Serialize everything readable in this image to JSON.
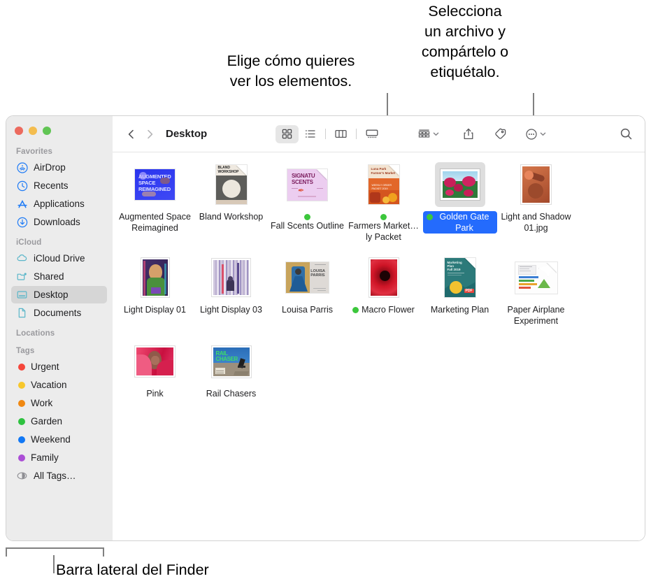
{
  "annotations": {
    "view_modes": "Elige cómo quieres\nver los elementos.",
    "share_tag": "Selecciona\nun archivo y\ncompártelo o\netiquétalo.",
    "sidebar_caption": "Barra lateral del Finder"
  },
  "window": {
    "traffic_lights": [
      "close",
      "minimize",
      "zoom"
    ],
    "title": "Desktop"
  },
  "toolbar": {
    "back_label": "Back",
    "forward_label": "Forward",
    "view_icon": "grid-view-icon",
    "list_icon": "list-view-icon",
    "column_icon": "column-view-icon",
    "gallery_icon": "gallery-view-icon",
    "group_icon": "group-by-icon",
    "share_icon": "share-icon",
    "tag_icon": "tag-icon",
    "more_icon": "more-options-icon",
    "search_icon": "search-icon"
  },
  "sidebar": {
    "sections": [
      {
        "header": "Favorites",
        "items": [
          {
            "label": "AirDrop",
            "icon": "airdrop-icon",
            "color": "#1e7bf6",
            "selected": false
          },
          {
            "label": "Recents",
            "icon": "clock-icon",
            "color": "#1e7bf6",
            "selected": false
          },
          {
            "label": "Applications",
            "icon": "applications-icon",
            "color": "#1e7bf6",
            "selected": false
          },
          {
            "label": "Downloads",
            "icon": "downloads-icon",
            "color": "#1e7bf6",
            "selected": false
          }
        ]
      },
      {
        "header": "iCloud",
        "items": [
          {
            "label": "iCloud Drive",
            "icon": "cloud-icon",
            "color": "#5ab6c9",
            "selected": false
          },
          {
            "label": "Shared",
            "icon": "shared-folder-icon",
            "color": "#5ab6c9",
            "selected": false
          },
          {
            "label": "Desktop",
            "icon": "desktop-icon",
            "color": "#5ab6c9",
            "selected": true
          },
          {
            "label": "Documents",
            "icon": "document-icon",
            "color": "#5ab6c9",
            "selected": false
          }
        ]
      },
      {
        "header": "Locations",
        "items": []
      },
      {
        "header": "Tags",
        "items": [
          {
            "label": "Urgent",
            "icon": "tag-dot",
            "color": "#f5463b",
            "selected": false
          },
          {
            "label": "Vacation",
            "icon": "tag-dot",
            "color": "#f7c72c",
            "selected": false
          },
          {
            "label": "Work",
            "icon": "tag-dot",
            "color": "#f08812",
            "selected": false
          },
          {
            "label": "Garden",
            "icon": "tag-dot",
            "color": "#2ec23f",
            "selected": false
          },
          {
            "label": "Weekend",
            "icon": "tag-dot",
            "color": "#1178f5",
            "selected": false
          },
          {
            "label": "Family",
            "icon": "tag-dot",
            "color": "#ab4ed6",
            "selected": false
          },
          {
            "label": "All Tags…",
            "icon": "all-tags-icon",
            "color": "#8e8e93",
            "selected": false
          }
        ]
      }
    ]
  },
  "files": [
    {
      "name": "Augmented Space Reimagined",
      "kind": "doc",
      "tag": null,
      "selected": false,
      "art": "augmented"
    },
    {
      "name": "Bland Workshop",
      "kind": "doc",
      "tag": null,
      "selected": false,
      "art": "bland"
    },
    {
      "name": "Fall Scents Outline",
      "kind": "doc",
      "tag": "#3cc73c",
      "selected": false,
      "art": "scents"
    },
    {
      "name": "Farmers Market…ly Packet",
      "kind": "doc",
      "tag": "#3cc73c",
      "selected": false,
      "art": "farmers"
    },
    {
      "name": "Golden Gate Park",
      "kind": "photo",
      "tag": "#3cc73c",
      "selected": true,
      "art": "golden"
    },
    {
      "name": "Light and Shadow 01.jpg",
      "kind": "photo",
      "tag": null,
      "selected": false,
      "art": "shadow"
    },
    {
      "name": "Light Display 01",
      "kind": "photo",
      "tag": null,
      "selected": false,
      "art": "display01"
    },
    {
      "name": "Light Display 03",
      "kind": "photo",
      "tag": null,
      "selected": false,
      "art": "display03"
    },
    {
      "name": "Louisa Parris",
      "kind": "doc",
      "tag": null,
      "selected": false,
      "art": "louisa"
    },
    {
      "name": "Macro Flower",
      "kind": "photo",
      "tag": "#3cc73c",
      "selected": false,
      "art": "macro"
    },
    {
      "name": "Marketing Plan",
      "kind": "doc",
      "tag": null,
      "selected": false,
      "art": "marketing"
    },
    {
      "name": "Paper Airplane Experiment",
      "kind": "doc",
      "tag": null,
      "selected": false,
      "art": "airplane"
    },
    {
      "name": "Pink",
      "kind": "photo",
      "tag": null,
      "selected": false,
      "art": "pink"
    },
    {
      "name": "Rail Chasers",
      "kind": "photo",
      "tag": null,
      "selected": false,
      "art": "rail"
    }
  ],
  "colors": {
    "selection_blue": "#246bfd",
    "sidebar_bg": "#ececec",
    "selected_row": "#d6d6d6"
  }
}
